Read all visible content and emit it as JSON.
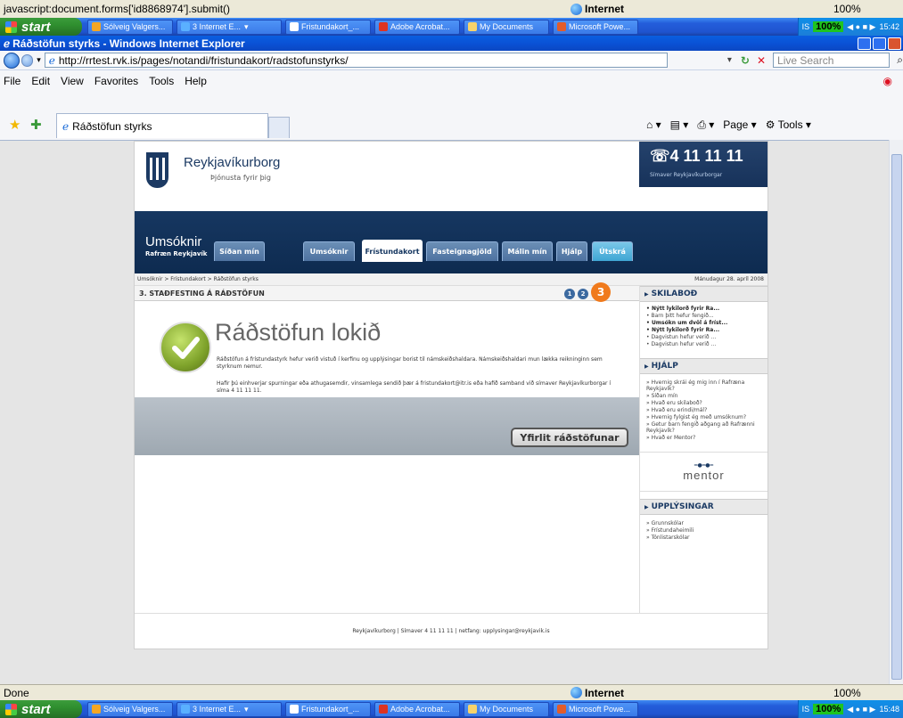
{
  "top_status": {
    "text": "javascript:document.forms['id8868974'].submit()",
    "zone": "Internet",
    "zoom": "100%"
  },
  "taskbar": {
    "start": "start",
    "buttons": [
      "Sólveig Valgers...",
      "3 Internet E...",
      "Fristundakort_...",
      "Adobe Acrobat...",
      "My Documents",
      "Microsoft Powe..."
    ],
    "tray_ime": "IS",
    "tray_pct": "100%",
    "clock_top": "15:42",
    "clock_bottom": "15:48"
  },
  "window": {
    "title": "Ráðstöfun styrks - Windows Internet Explorer"
  },
  "address": {
    "url": "http://rrtest.rvk.is/pages/notandi/fristundakort/radstofunstyrks/",
    "search_placeholder": "Live Search"
  },
  "menu": [
    "File",
    "Edit",
    "View",
    "Favorites",
    "Tools",
    "Help"
  ],
  "tab": {
    "label": "Ráðstöfun styrks"
  },
  "toolbar_right": {
    "page": "Page",
    "tools": "Tools"
  },
  "site": {
    "brand": "Reykjavíkurborg",
    "tagline": "Þjónusta fyrir þig",
    "phone": "4 11 11 11",
    "phone_sub": "Símaver Reykjavíkurborgar",
    "section_title": "Umsóknir",
    "section_sub": "Rafræn Reykjavík",
    "tabs": [
      "Síðan mín",
      "Umsóknir",
      "Frístundakort",
      "Fasteignagjöld",
      "Málin mín",
      "Hjálp",
      "Útskrá"
    ],
    "active_tab": "Frístundakort",
    "breadcrumb": "Umsóknir > Frístundakort > Ráðstöfun styrks",
    "date": "Mánudagur 28. apríl 2008",
    "step_title": "3. STAÐFESTING Á RÁÐSTÖFUN",
    "steps": [
      "1",
      "2",
      "3"
    ],
    "heading": "Ráðstöfun lokið",
    "para1": "Ráðstöfun á frístundastyrk hefur verið vistuð í kerfinu og upplýsingar borist til námskeiðshaldara. Námskeiðshaldari mun lækka reikninginn sem styrknum nemur.",
    "para2": "Hafir þú einhverjar spurningar eða athugasemdir, vinsamlega sendið þær á fristundakort@itr.is eða hafið samband við símaver Reykjavíkurborgar í síma 4 11 11 11.",
    "button": "Yfirlit ráðstöfunar",
    "footer": "Reykjavíkurborg | Símaver 4 11 11 11 | netfang: upplysingar@reykjavik.is"
  },
  "sidebar": {
    "skilabod_title": "SKILABOÐ",
    "skilabod": [
      {
        "text": "Nýtt lykilorð fyrir Ra...",
        "bold": true
      },
      {
        "text": "Barn þitt hefur fengið...",
        "bold": false
      },
      {
        "text": "Umsókn um dvöl á fríst...",
        "bold": true
      },
      {
        "text": "Nýtt lykilorð fyrir Ra...",
        "bold": true
      },
      {
        "text": "Dagvistun hefur verið ...",
        "bold": false
      },
      {
        "text": "Dagvistun hefur verið ...",
        "bold": false
      }
    ],
    "hjalp_title": "HJÁLP",
    "hjalp": [
      "Hvernig skrái ég mig inn í Rafræna Reykjavík?",
      "Síðan mín",
      "Hvað eru skilaboð?",
      "Hvað eru erindi/mál?",
      "Hvernig fylgist ég með umsóknum?",
      "Getur barn fengið aðgang að Rafrænni Reykjavík?",
      "Hvað er Mentor?"
    ],
    "mentor": "mentor",
    "upplysingar_title": "UPPLÝSINGAR",
    "upplysingar": [
      "Grunnskólar",
      "Frístundaheimili",
      "Tónlistarskólar"
    ]
  },
  "status": {
    "text": "Done",
    "zone": "Internet",
    "zoom": "100%"
  },
  "colors": {
    "accent": "#163761",
    "step_active": "#f07a1c",
    "check": "#7fa32b"
  }
}
